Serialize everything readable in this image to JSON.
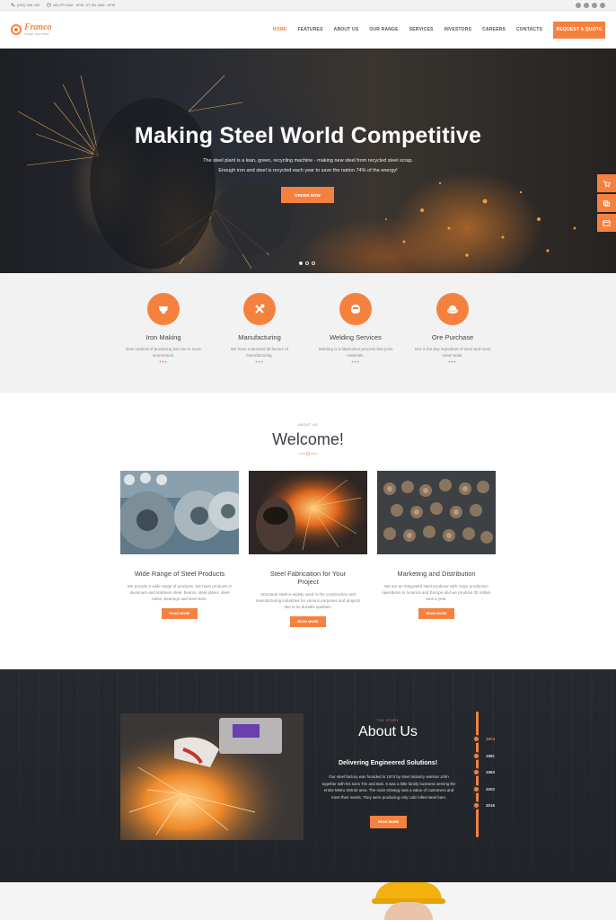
{
  "topbar": {
    "phone": "(000) 456-789",
    "hours": "MN-FR 9AM - 6PM, ST-SN 9AM - 6PM"
  },
  "header": {
    "logo_name": "Franco",
    "logo_sub": "STEEL FACTORY",
    "nav": [
      "HOME",
      "FEATURES",
      "ABOUT US",
      "OUR RANGE",
      "SERVICES",
      "INVESTORS",
      "CAREERS",
      "CONTACTS"
    ],
    "active_nav": "HOME",
    "quote_button": "REQUEST A QUOTE"
  },
  "hero": {
    "title": "Making Steel World Competitive",
    "subtitle_line1": "The steel plant is a lean, green, recycling machine - making new steel from recycled steel scrap.",
    "subtitle_line2": "Enough iron and steel is recycled each year to save the nation 74% of the energy!",
    "button": "ORDER NOW"
  },
  "services": [
    {
      "title": "Iron Making",
      "text": "New method of producing bar iron is more economical.",
      "icon": "iron-ladle-icon"
    },
    {
      "title": "Manufacturing",
      "text": "We have examined all factors of manufacturing.",
      "icon": "tools-icon"
    },
    {
      "title": "Welding Services",
      "text": "Welding is a fabrication process that joins materials.",
      "icon": "welding-mask-icon"
    },
    {
      "title": "Ore Purchase",
      "text": "Ore is the key ingredient of steel and most used metal.",
      "icon": "ore-pile-icon"
    }
  ],
  "welcome": {
    "eyebrow": "ABOUT US",
    "title": "Welcome!",
    "cards": [
      {
        "title": "Wide Range of Steel Products",
        "text": "We provide a wide range of products. We have products in aluminum and stainless steel, beams, steel plates, steel tubes, bearings and steel bars.",
        "button": "READ MORE"
      },
      {
        "title": "Steel Fabrication for Your Project",
        "text": "Structural steel is widely used in the construction and manufacturing industries for various purposes and projects due to its durable qualities.",
        "button": "READ MORE"
      },
      {
        "title": "Marketing and Distribution",
        "text": "We are an integrated steel producer with major production operations in America and Europe and we produce 30 million tons a year.",
        "button": "READ MORE"
      }
    ]
  },
  "about": {
    "eyebrow": "THE STORY",
    "title": "About Us",
    "subtitle": "Delivering Engineered Solutions!",
    "text": "Our steel factory was founded in 1974 by steel industry veteran John together with his sons Tim and Bob. It was a little family business serving the entire Metro Detroit area. The main strategy was a value of customers and meet their needs. They were producing only cold rolled steel bars.",
    "button": "READ MORE",
    "timeline": [
      "1974",
      "1981",
      "1993",
      "2002",
      "2016"
    ],
    "active_year": "1974"
  },
  "colors": {
    "accent": "#f5813f",
    "dark": "#2b2e33",
    "light_gray": "#f2f2f2"
  }
}
